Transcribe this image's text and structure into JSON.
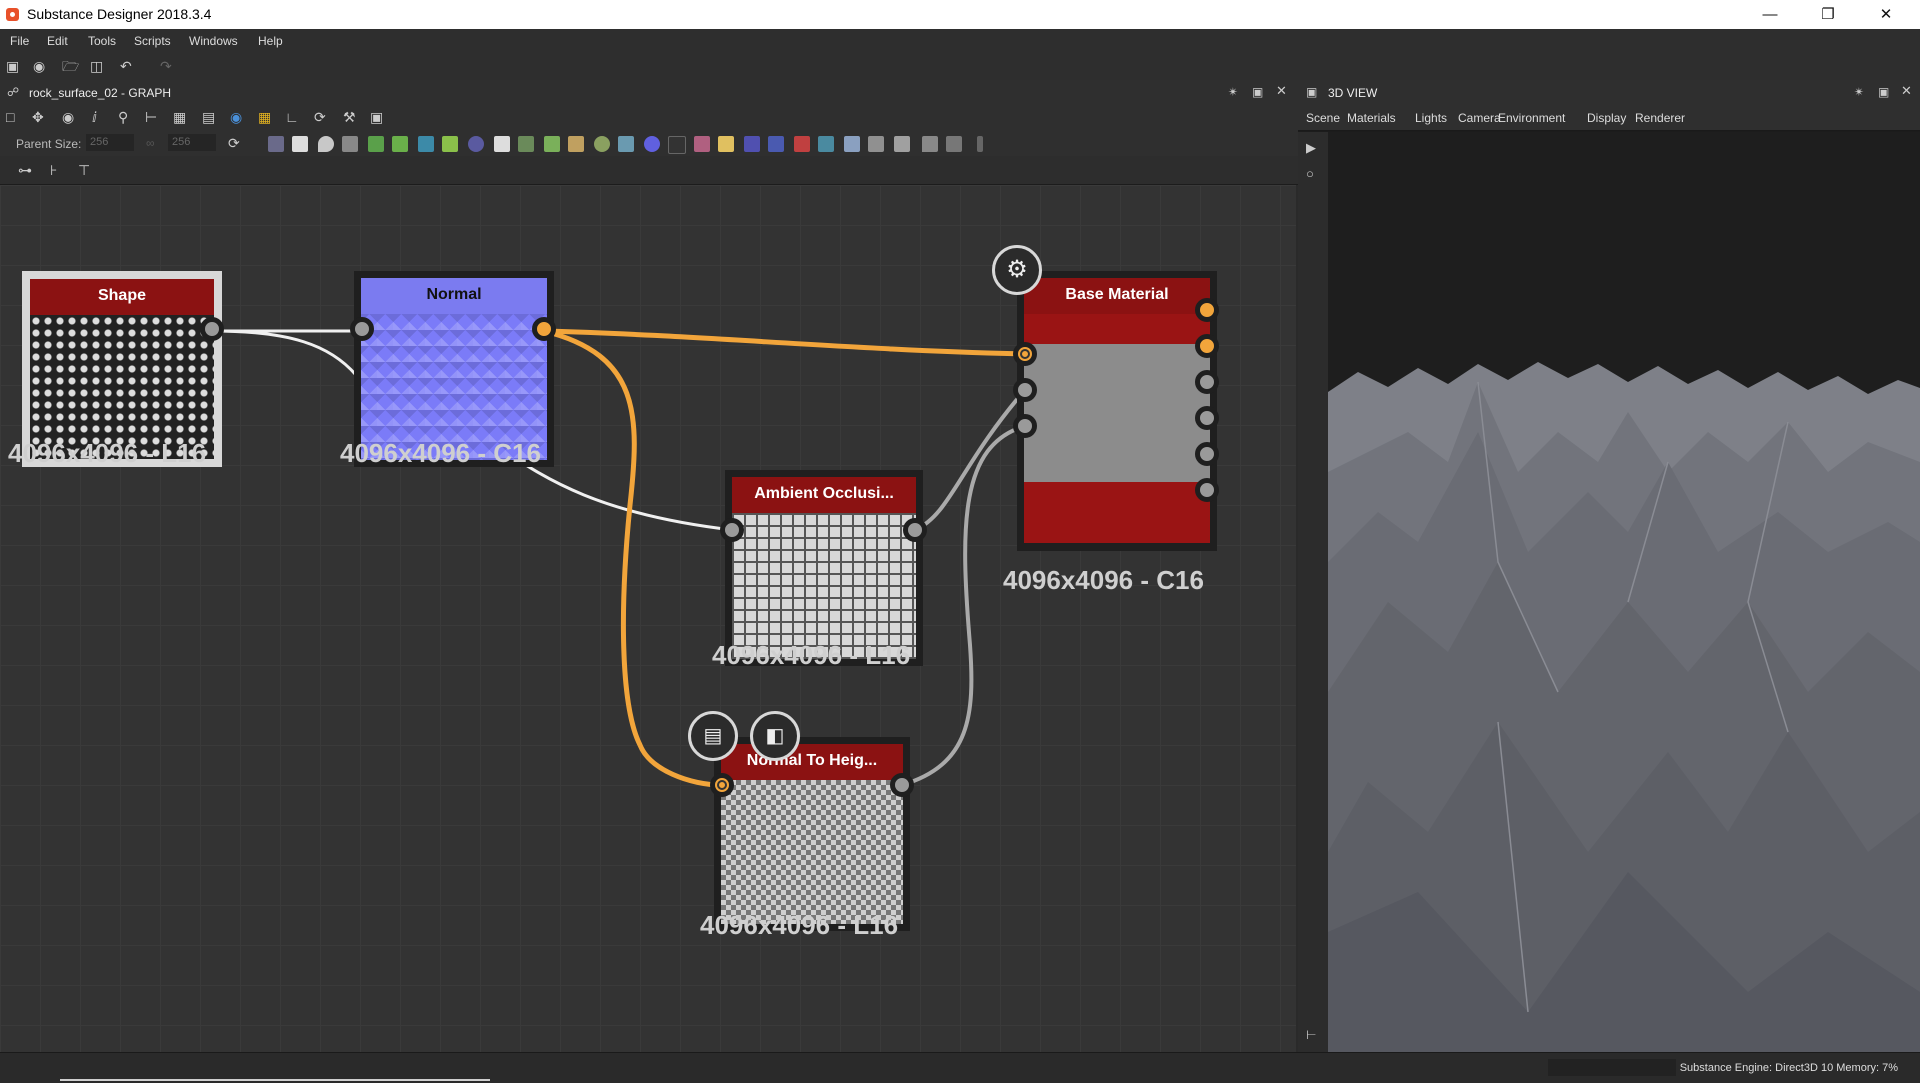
{
  "window": {
    "title": "Substance Designer 2018.3.4"
  },
  "menu": [
    "File",
    "Edit",
    "Tools",
    "Scripts",
    "Windows",
    "Help"
  ],
  "graph": {
    "panel_title": "rock_surface_02 - GRAPH",
    "parent_size_label": "Parent Size:",
    "parent_size_w": "256",
    "parent_size_h": "256",
    "nodes": [
      {
        "title": "Shape",
        "res": "4096x4096 - L16",
        "head_color": "#8b1212"
      },
      {
        "title": "Normal",
        "res": "4096x4096 - C16",
        "head_color": "#7b7bf0"
      },
      {
        "title": "Ambient Occlusi...",
        "res": "4096x4096 - L16",
        "head_color": "#8b1212"
      },
      {
        "title": "Base Material",
        "res": "4096x4096 - C16",
        "head_color": "#8b1212"
      },
      {
        "title": "Normal To Heig...",
        "res": "4096x4096 - L16",
        "head_color": "#8b1212"
      }
    ],
    "link_color": "#f2a53b"
  },
  "view3d": {
    "panel_title": "3D VIEW",
    "menu": [
      "Scene",
      "Materials",
      "Lights",
      "Camera",
      "Environment",
      "Display",
      "Renderer"
    ]
  },
  "status": {
    "engine": "Substance Engine: Direct3D 10  Memory: 7%"
  }
}
